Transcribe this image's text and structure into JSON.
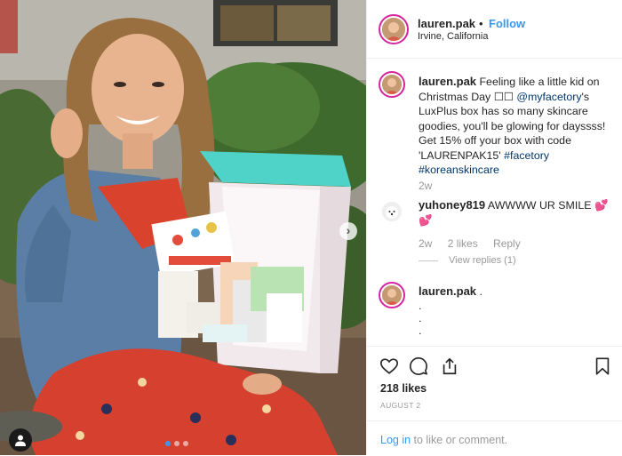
{
  "post": {
    "author": "lauren.pak",
    "separator": "•",
    "follow_label": "Follow",
    "location": "Irvine, California"
  },
  "caption": {
    "username": "lauren.pak",
    "text_1": "Feeling like a little kid on Christmas Day",
    "emoji_placeholder": "☐☐",
    "mention": "@myfacetory",
    "text_2": "'s LuxPlus box has so many skincare goodies, you'll be glowing for dayssss! Get 15% off your box with code 'LAURENPAK15'",
    "hashtag_1": "#facetory",
    "hashtag_2": "#koreanskincare",
    "time": "2w"
  },
  "comment_1": {
    "username": "yuhoney819",
    "text": "AWWWW UR SMILE",
    "emoji": "💕💕",
    "time": "2w",
    "likes": "2 likes",
    "reply_label": "Reply",
    "view_replies": "View replies (1)"
  },
  "comment_2": {
    "username": "lauren.pak",
    "text": ".",
    "lines": [
      ".",
      ".",
      "."
    ]
  },
  "actions": {
    "icons": [
      "heart-icon",
      "comment-icon",
      "share-icon",
      "bookmark-icon"
    ]
  },
  "likes_count": "218 likes",
  "date": "AUGUST 2",
  "login": {
    "link_label": "Log in",
    "rest": " to like or comment."
  },
  "carousel": {
    "dots": 3,
    "active_dot": 1
  },
  "colors": {
    "link": "#00376b",
    "follow": "#3897f0",
    "muted": "#999999",
    "story_ring": "#d6249f"
  }
}
